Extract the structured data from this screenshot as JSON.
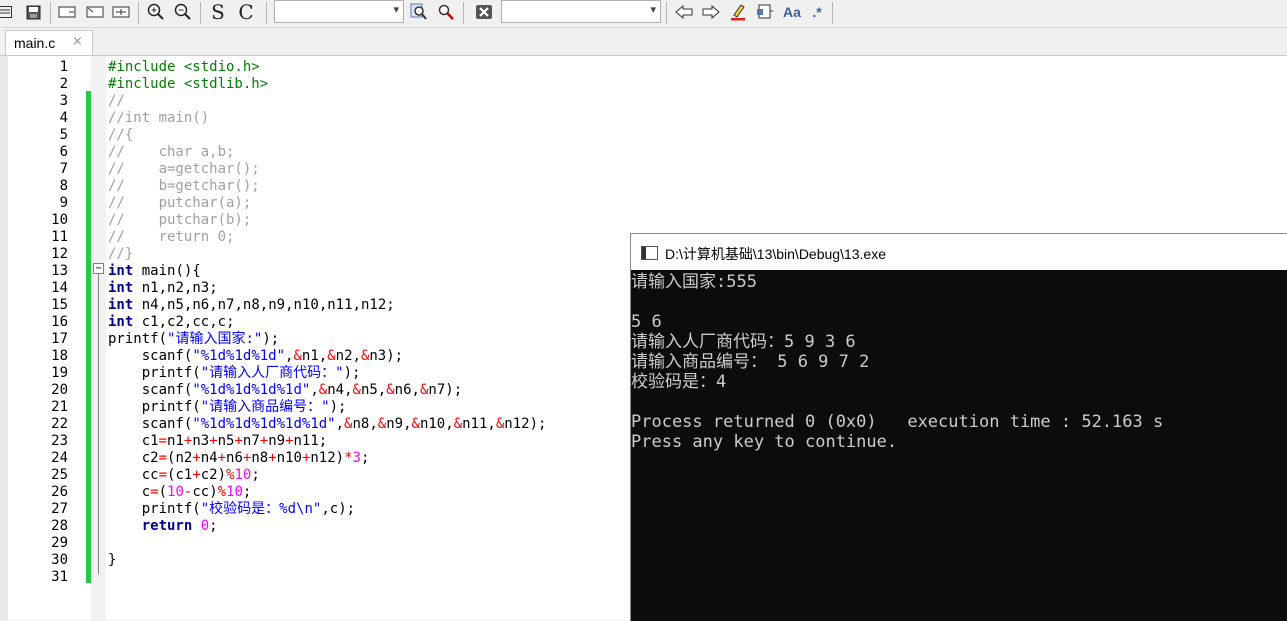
{
  "toolbar": {
    "combo1_value": "",
    "combo2_value": "",
    "s_label": "S",
    "c_label": "C",
    "aa_label": "Aa",
    "regex_label": ".*"
  },
  "tabs": [
    {
      "label": "main.c",
      "close": "×"
    }
  ],
  "editor": {
    "fold_marker": "−",
    "line_numbers": [
      "1",
      "2",
      "3",
      "4",
      "5",
      "6",
      "7",
      "8",
      "9",
      "10",
      "11",
      "12",
      "13",
      "14",
      "15",
      "16",
      "17",
      "18",
      "19",
      "20",
      "21",
      "22",
      "23",
      "24",
      "25",
      "26",
      "27",
      "28",
      "29",
      "30",
      "31"
    ],
    "lines": [
      "#include <stdio.h>",
      "#include <stdlib.h>",
      "//",
      "//int main()",
      "//{",
      "//    char a,b;",
      "//    a=getchar();",
      "//    b=getchar();",
      "//    putchar(a);",
      "//    putchar(b);",
      "//    return 0;",
      "//}",
      "int main(){",
      "int n1,n2,n3;",
      "int n4,n5,n6,n7,n8,n9,n10,n11,n12;",
      "int c1,c2,cc,c;",
      "printf(\"请输入国家:\");",
      "    scanf(\"%1d%1d%1d\",&n1,&n2,&n3);",
      "    printf(\"请输入人厂商代码：\");",
      "    scanf(\"%1d%1d%1d%1d\",&n4,&n5,&n6,&n7);",
      "    printf(\"请输入商品编号：\");",
      "    scanf(\"%1d%1d%1d%1d%1d\",&n8,&n9,&n10,&n11,&n12);",
      "    c1=n1+n3+n5+n7+n9+n11;",
      "    c2=(n2+n4+n6+n8+n10+n12)*3;",
      "    cc=(c1+c2)%10;",
      "    c=(10-cc)%10;",
      "    printf(\"校验码是：%d\\n\",c);",
      "    return 0;",
      "",
      "}",
      ""
    ],
    "colors": {
      "preprocessor": "#008000",
      "comment": "#a0a0a0",
      "keyword": "#00008b",
      "string": "#0000ff",
      "number": "#ff00ff",
      "operator": "#ff0000",
      "text": "#000000",
      "change_bar": "#22cc44"
    }
  },
  "console": {
    "title": "D:\\计算机基础\\13\\bin\\Debug\\13.exe",
    "lines": [
      "请输入国家:555",
      "",
      "5 6",
      "请输入人厂商代码：5 9 3 6",
      "请输入商品编号： 5 6 9 7 2",
      "校验码是：4",
      "",
      "Process returned 0 (0x0)   execution time : 52.163 s",
      "Press any key to continue."
    ]
  }
}
